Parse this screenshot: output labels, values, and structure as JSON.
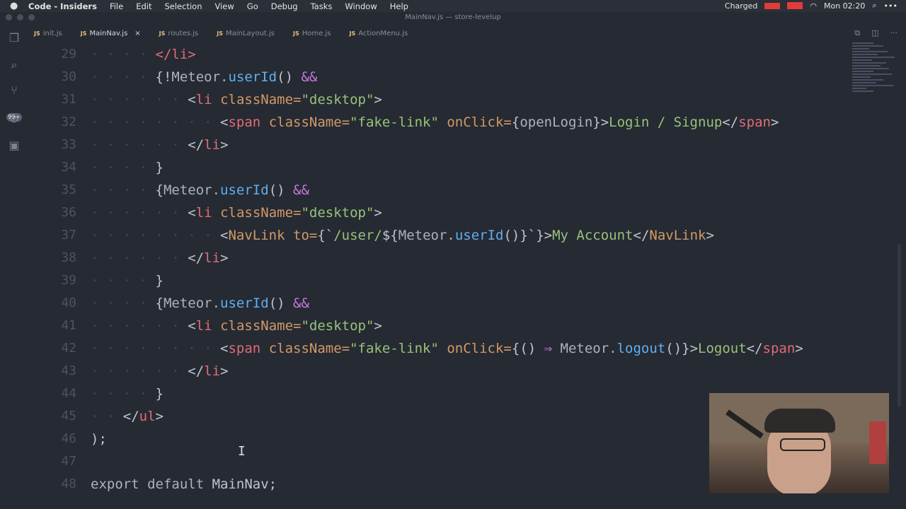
{
  "menubar": {
    "app": "Code - Insiders",
    "items": [
      "File",
      "Edit",
      "Selection",
      "View",
      "Go",
      "Debug",
      "Tasks",
      "Window",
      "Help"
    ],
    "window_title": "MainNav.js — store-levelup",
    "status": "Charged",
    "clock": "Mon 02:20",
    "more": "•••"
  },
  "activity": {
    "badge": "99+"
  },
  "tabs": [
    {
      "label": "init.js",
      "active": false
    },
    {
      "label": "MainNav.js",
      "active": true,
      "close": "×"
    },
    {
      "label": "routes.js",
      "active": false
    },
    {
      "label": "MainLayout.js",
      "active": false
    },
    {
      "label": "Home.js",
      "active": false
    },
    {
      "label": "ActionMenu.js",
      "active": false
    }
  ],
  "tab_icon": "JS",
  "editor": {
    "lines": [
      {
        "num": "29",
        "tokens": [
          [
            "dot",
            "· · · · "
          ],
          [
            "tg",
            "</li>"
          ]
        ]
      },
      {
        "num": "30",
        "tokens": [
          [
            "dot",
            "· · · · "
          ],
          [
            "p",
            "{!"
          ],
          [
            "cm",
            "Meteor."
          ],
          [
            "fn",
            "userId"
          ],
          [
            "p",
            "() "
          ],
          [
            "kw",
            "&&"
          ]
        ]
      },
      {
        "num": "31",
        "tokens": [
          [
            "dot",
            "· · · · · · "
          ],
          [
            "p",
            "<"
          ],
          [
            "tg",
            "li "
          ],
          [
            "at",
            "className="
          ],
          [
            "st",
            "\"desktop\""
          ],
          [
            "p",
            ">"
          ]
        ]
      },
      {
        "num": "32",
        "tokens": [
          [
            "dot",
            "· · · · · · · · "
          ],
          [
            "p",
            "<"
          ],
          [
            "tg",
            "span "
          ],
          [
            "at",
            "className="
          ],
          [
            "st",
            "\"fake-link\" "
          ],
          [
            "at",
            "onClick="
          ],
          [
            "p",
            "{"
          ],
          [
            "cm",
            "openLogin"
          ],
          [
            "p",
            "}>"
          ],
          [
            "st",
            "Login / Signup"
          ],
          [
            "p",
            "</"
          ],
          [
            "tg",
            "span"
          ],
          [
            "p",
            ">"
          ]
        ]
      },
      {
        "num": "33",
        "tokens": [
          [
            "dot",
            "· · · · · · "
          ],
          [
            "p",
            "</"
          ],
          [
            "tg",
            "li"
          ],
          [
            "p",
            ">"
          ]
        ]
      },
      {
        "num": "34",
        "tokens": [
          [
            "dot",
            "· · · · "
          ],
          [
            "p",
            "}"
          ]
        ]
      },
      {
        "num": "35",
        "tokens": [
          [
            "dot",
            "· · · · "
          ],
          [
            "p",
            "{"
          ],
          [
            "cm",
            "Meteor."
          ],
          [
            "fn",
            "userId"
          ],
          [
            "p",
            "() "
          ],
          [
            "kw",
            "&&"
          ]
        ]
      },
      {
        "num": "36",
        "tokens": [
          [
            "dot",
            "· · · · · · "
          ],
          [
            "p",
            "<"
          ],
          [
            "tg",
            "li "
          ],
          [
            "at",
            "className="
          ],
          [
            "st",
            "\"desktop\""
          ],
          [
            "p",
            ">"
          ]
        ]
      },
      {
        "num": "37",
        "tokens": [
          [
            "dot",
            "· · · · · · · · "
          ],
          [
            "p",
            "<"
          ],
          [
            "at",
            "NavLink "
          ],
          [
            "at",
            "to="
          ],
          [
            "p",
            "{`"
          ],
          [
            "st",
            "/user/"
          ],
          [
            "p",
            "${"
          ],
          [
            "cm",
            "Meteor."
          ],
          [
            "fn",
            "userId"
          ],
          [
            "p",
            "()}`}>"
          ],
          [
            "st",
            "My Account"
          ],
          [
            "p",
            "</"
          ],
          [
            "at",
            "NavLink"
          ],
          [
            "p",
            ">"
          ]
        ]
      },
      {
        "num": "38",
        "tokens": [
          [
            "dot",
            "· · · · · · "
          ],
          [
            "p",
            "</"
          ],
          [
            "tg",
            "li"
          ],
          [
            "p",
            ">"
          ]
        ]
      },
      {
        "num": "39",
        "tokens": [
          [
            "dot",
            "· · · · "
          ],
          [
            "p",
            "}"
          ]
        ]
      },
      {
        "num": "40",
        "tokens": [
          [
            "dot",
            "· · · · "
          ],
          [
            "p",
            "{"
          ],
          [
            "cm",
            "Meteor."
          ],
          [
            "fn",
            "userId"
          ],
          [
            "p",
            "() "
          ],
          [
            "kw",
            "&&"
          ]
        ]
      },
      {
        "num": "41",
        "tokens": [
          [
            "dot",
            "· · · · · · "
          ],
          [
            "p",
            "<"
          ],
          [
            "tg",
            "li "
          ],
          [
            "at",
            "className="
          ],
          [
            "st",
            "\"desktop\""
          ],
          [
            "p",
            ">"
          ]
        ]
      },
      {
        "num": "42",
        "tokens": [
          [
            "dot",
            "· · · · · · · · "
          ],
          [
            "p",
            "<"
          ],
          [
            "tg",
            "span "
          ],
          [
            "at",
            "className="
          ],
          [
            "st",
            "\"fake-link\" "
          ],
          [
            "at",
            "onClick="
          ],
          [
            "p",
            "{() "
          ],
          [
            "kw",
            "⇒ "
          ],
          [
            "cm",
            "Meteor."
          ],
          [
            "fn",
            "logout"
          ],
          [
            "p",
            "()}>"
          ],
          [
            "st",
            "Logout"
          ],
          [
            "p",
            "</"
          ],
          [
            "tg",
            "span"
          ],
          [
            "p",
            ">"
          ]
        ]
      },
      {
        "num": "43",
        "tokens": [
          [
            "dot",
            "· · · · · · "
          ],
          [
            "p",
            "</"
          ],
          [
            "tg",
            "li"
          ],
          [
            "p",
            ">"
          ]
        ]
      },
      {
        "num": "44",
        "tokens": [
          [
            "dot",
            "· · · · "
          ],
          [
            "p",
            "}"
          ]
        ]
      },
      {
        "num": "45",
        "tokens": [
          [
            "dot",
            "· · "
          ],
          [
            "p",
            "</"
          ],
          [
            "tg",
            "ul"
          ],
          [
            "p",
            ">"
          ]
        ]
      },
      {
        "num": "46",
        "tokens": [
          [
            "p",
            ");"
          ]
        ]
      },
      {
        "num": "47",
        "tokens": []
      },
      {
        "num": "48",
        "tokens": [
          [
            "cm",
            "export default "
          ],
          [
            "p",
            "MainNav;"
          ]
        ]
      }
    ]
  },
  "colors": {
    "background": "#262a33",
    "tag": "#e06c75",
    "attribute": "#d19a66",
    "string": "#98c379",
    "keyword": "#c678dd",
    "function": "#61afef"
  }
}
